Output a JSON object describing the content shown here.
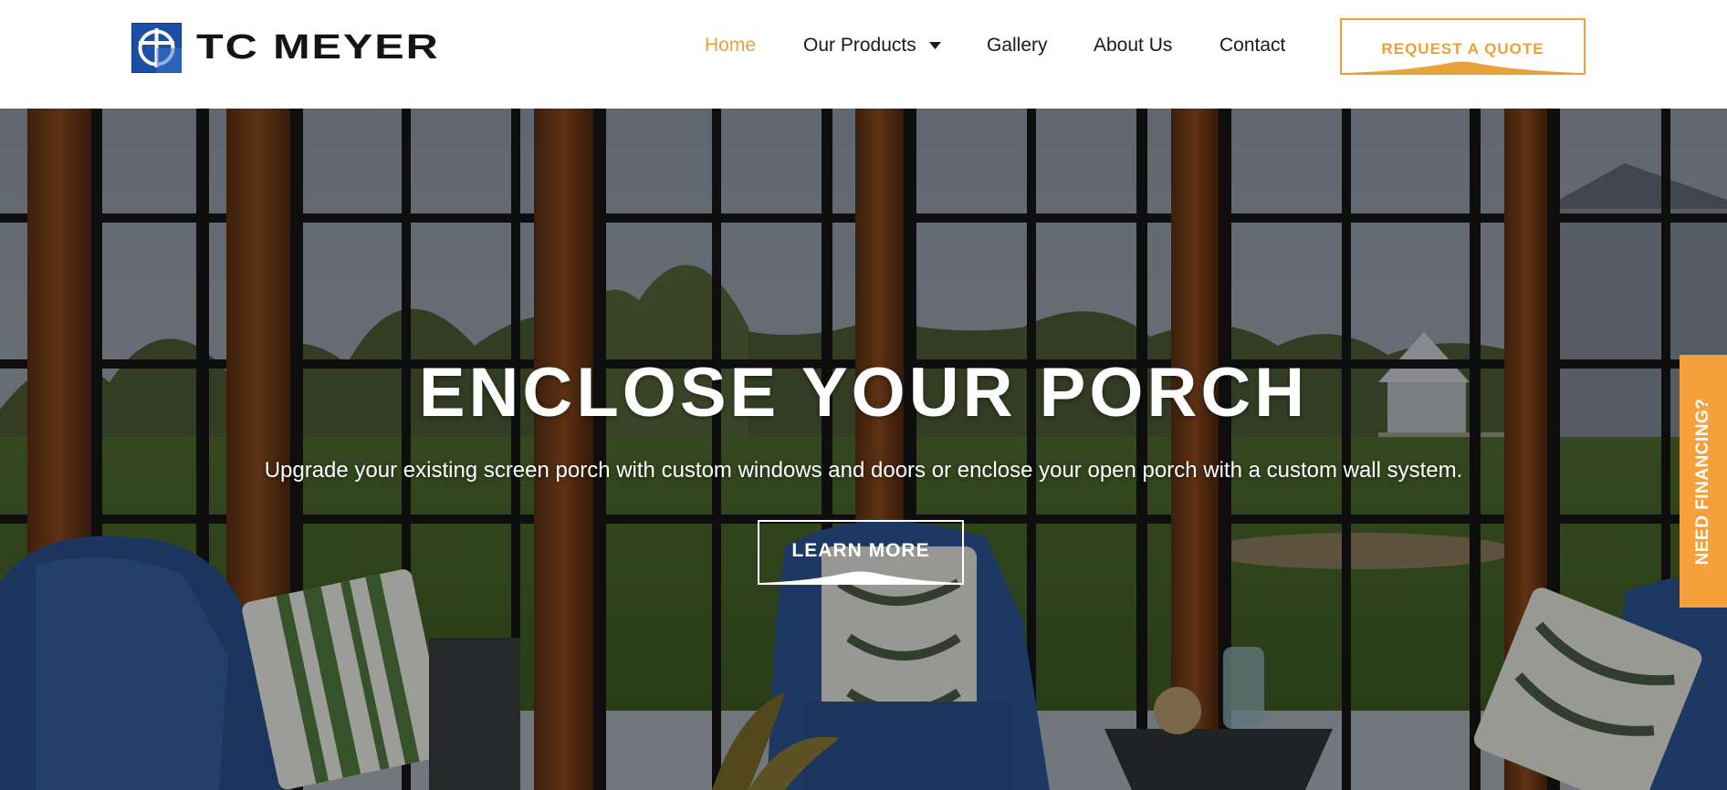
{
  "brand": {
    "name": "TC MEYER",
    "logo_icon": "tc-meyer-logo-mark",
    "logo_color": "#1c4fa6"
  },
  "nav": {
    "items": [
      {
        "label": "Home",
        "active": true
      },
      {
        "label": "Our Products",
        "has_dropdown": true,
        "dropdown_icon": "caret-down-icon"
      },
      {
        "label": "Gallery"
      },
      {
        "label": "About Us"
      },
      {
        "label": "Contact"
      }
    ],
    "active_color": "#e9a23b"
  },
  "header_cta": {
    "label": "REQUEST A QUOTE",
    "color": "#e9a23b"
  },
  "hero": {
    "title": "ENCLOSE YOUR PORCH",
    "subtitle": "Upgrade your existing screen porch with custom windows and doors or enclose your open porch with a custom wall system.",
    "button_label": "LEARN MORE"
  },
  "side_tab": {
    "label": "NEED FINANCING?",
    "color": "#f5a03a"
  }
}
